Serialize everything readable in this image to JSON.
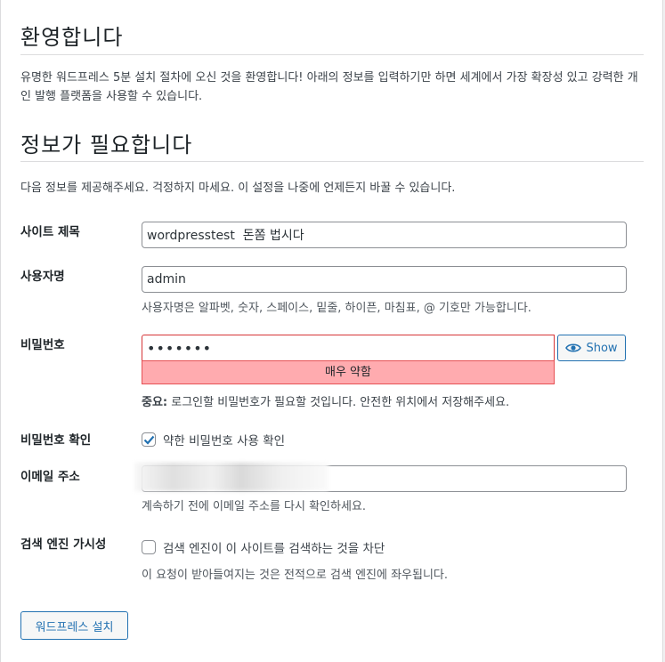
{
  "welcome": {
    "title": "환영합니다",
    "text": "유명한 워드프레스 5분 설치 절차에 오신 것을 환영합니다! 아래의 정보를 입력하기만 하면 세계에서 가장 확장성 있고 강력한 개인 발행 플랫폼을 사용할 수 있습니다."
  },
  "info": {
    "title": "정보가 필요합니다",
    "text": "다음 정보를 제공해주세요. 걱정하지 마세요. 이 설정을 나중에 언제든지 바꿀 수 있습니다."
  },
  "form": {
    "site_title": {
      "label": "사이트 제목",
      "value": "wordpresstest  돈쫌 법시다"
    },
    "username": {
      "label": "사용자명",
      "value": "admin",
      "hint": "사용자명은 알파벳, 숫자, 스페이스, 밑줄, 하이픈, 마침표, @ 기호만 가능합니다."
    },
    "password": {
      "label": "비밀번호",
      "value": "•••••••",
      "show_label": "Show",
      "strength": "매우 약함",
      "note_strong": "중요:",
      "note_text": " 로그인할 비밀번호가 필요할 것입니다. 안전한 위치에서 저장해주세요."
    },
    "confirm": {
      "label": "비밀번호 확인",
      "checkbox_label": "약한 비밀번호 사용 확인",
      "checked": true
    },
    "email": {
      "label": "이메일 주소",
      "value": "",
      "hint": "계속하기 전에 이메일 주소를 다시 확인하세요."
    },
    "search": {
      "label": "검색 엔진 가시성",
      "checkbox_label": "검색 엔진이 이 사이트를 검색하는 것을 차단",
      "checked": false,
      "hint": "이 요청이 받아들여지는 것은 전적으로 검색 엔진에 좌우됩니다."
    }
  },
  "install_button": "워드프레스 설치",
  "colors": {
    "accent": "#2271b1",
    "weak_bg": "#ffabaf",
    "weak_border": "#d63638"
  }
}
